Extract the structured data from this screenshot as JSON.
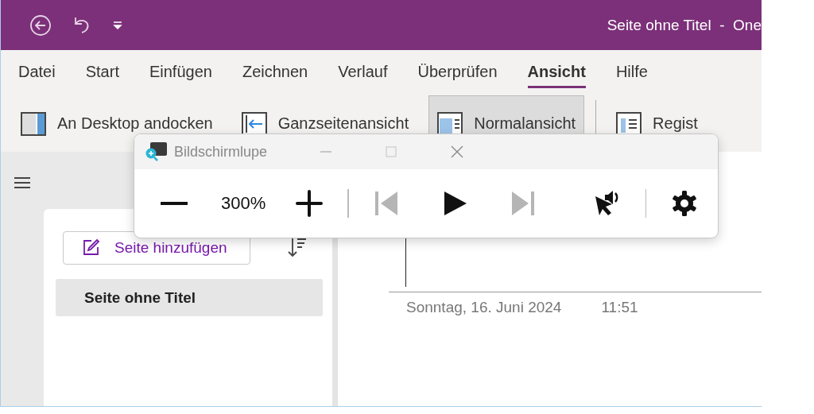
{
  "window": {
    "title": "Seite ohne Titel  -  One"
  },
  "tabs": [
    {
      "label": "Datei",
      "selected": false
    },
    {
      "label": "Start",
      "selected": false
    },
    {
      "label": "Einfügen",
      "selected": false
    },
    {
      "label": "Zeichnen",
      "selected": false
    },
    {
      "label": "Verlauf",
      "selected": false
    },
    {
      "label": "Überprüfen",
      "selected": false
    },
    {
      "label": "Ansicht",
      "selected": true
    },
    {
      "label": "Hilfe",
      "selected": false
    }
  ],
  "ribbon": [
    {
      "kind": "dock",
      "label": "An Desktop andocken",
      "selected": false
    },
    {
      "kind": "fullpage",
      "label": "Ganzseitenansicht",
      "selected": false
    },
    {
      "kind": "normal",
      "label": "Normalansicht",
      "selected": true
    },
    {
      "kind": "tabs",
      "label": "Regist",
      "selected": false
    }
  ],
  "magnifier": {
    "title": "Bildschirmlupe",
    "zoom": "300%",
    "controls": [
      {
        "kind": "prev",
        "disabled": true
      },
      {
        "kind": "play",
        "disabled": false
      },
      {
        "kind": "next",
        "disabled": true
      },
      {
        "kind": "read",
        "disabled": false
      }
    ]
  },
  "sidebar": {
    "add_page": "Seite hinzufügen",
    "pages": [
      {
        "title": "Seite ohne Titel",
        "selected": true
      }
    ]
  },
  "page": {
    "date": "Sonntag, 16. Juni 2024",
    "time": "11:51"
  }
}
